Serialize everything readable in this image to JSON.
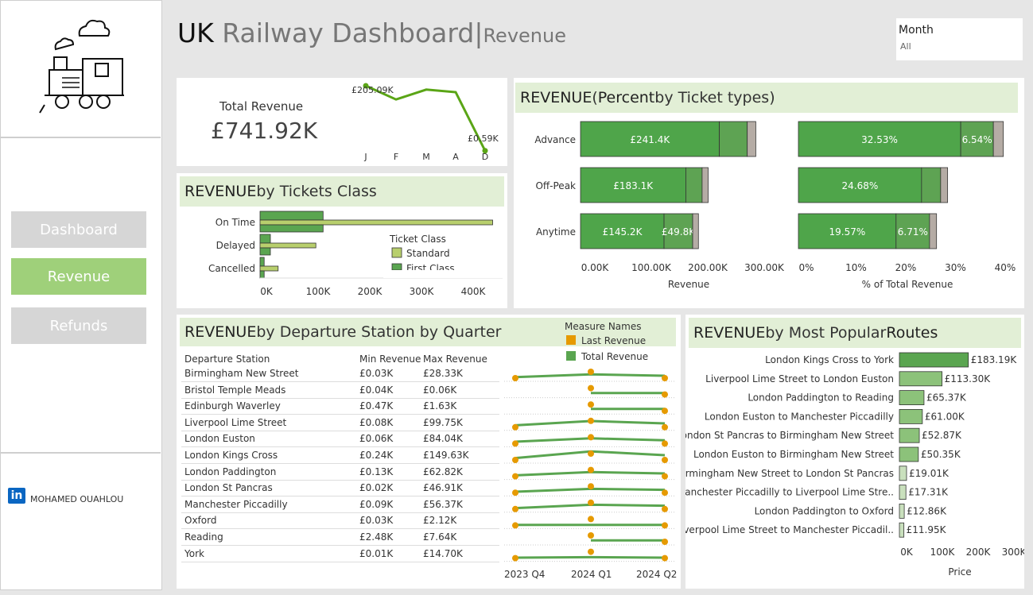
{
  "title": {
    "main_bold": "UK",
    "main_rest": " Railway Dashboard",
    "separator": "|",
    "sub": "Revenue"
  },
  "month_filter": {
    "label": "Month",
    "value": "All"
  },
  "nav": {
    "dashboard": "Dashboard",
    "revenue": "Revenue",
    "refunds": "Refunds",
    "active_color": "#9fd07a"
  },
  "author": {
    "name": "MOHAMED OUAHLOU",
    "icon": "linkedin-icon",
    "icon_text": "in"
  },
  "total_revenue": {
    "label": "Total Revenue",
    "value": "£741.92K",
    "spark": {
      "months": [
        "J",
        "F",
        "M",
        "A",
        "D"
      ],
      "values_k": [
        205.09,
        162,
        193,
        185,
        0.59
      ],
      "first_label": "£205.09K",
      "last_label": "£0.59K"
    }
  },
  "tickets_class": {
    "header_bold": "REVENUE",
    "header_rest": " by Tickets Class",
    "categories": [
      "On Time",
      "Delayed",
      "Cancelled"
    ],
    "standard_k": [
      450,
      108,
      35
    ],
    "first_class_k": [
      122,
      20,
      8
    ],
    "xticks": [
      "0K",
      "100K",
      "200K",
      "300K",
      "400K"
    ],
    "legend_title": "Ticket Class",
    "legend": [
      "Standard",
      "First Class"
    ],
    "colors": {
      "standard": "#b8cf6d",
      "first": "#5aa550"
    }
  },
  "ticket_types": {
    "header_bold1": "REVENUE",
    "header_mid1": " (",
    "header_bold2": "Percent",
    "header_rest": " by Ticket types)",
    "categories": [
      "Advance",
      "Off-Peak",
      "Anytime"
    ],
    "revenue": {
      "seg1": [
        241.4,
        183.1,
        145.2
      ],
      "seg2": [
        48.5,
        28.3,
        49.8
      ],
      "seg3": [
        14.8,
        10.5,
        10.0
      ],
      "seg1_labels": [
        "£241.4K",
        "£183.1K",
        "£145.2K"
      ],
      "seg2_labels": [
        "",
        "",
        "£49.8K"
      ],
      "xticks": [
        "0.00K",
        "100.00K",
        "200.00K",
        "300.00K"
      ],
      "xlabel": "Revenue"
    },
    "percent": {
      "seg1": [
        32.53,
        24.68,
        19.57
      ],
      "seg2": [
        6.54,
        3.82,
        6.71
      ],
      "seg3": [
        2.0,
        1.4,
        1.4
      ],
      "seg1_labels": [
        "32.53%",
        "24.68%",
        "19.57%"
      ],
      "seg2_labels": [
        "6.54%",
        "",
        "6.71%"
      ],
      "xticks": [
        "0%",
        "10%",
        "20%",
        "30%",
        "40%"
      ],
      "xlabel": "% of Total Revenue"
    },
    "colors": {
      "seg1": "#4fa54a",
      "seg2": "#5ea353",
      "seg3": "#b5aca5"
    }
  },
  "departure": {
    "header_bold": "REVENUE",
    "header_rest": " by Departure Station by Quarter",
    "legend_title": "Measure Names",
    "legend": [
      "Last Revenue",
      "Total Revenue"
    ],
    "colors": {
      "last": "#e69a00",
      "total": "#5aa550"
    },
    "columns": [
      "Departure Station",
      "Min Revenue",
      "Max Revenue"
    ],
    "quarters": [
      "2023 Q4",
      "2024 Q1",
      "2024 Q2"
    ],
    "rows": [
      {
        "station": "Birmingham New Street",
        "min": "£0.03K",
        "max": "£28.33K",
        "line": [
          0.1,
          0.4,
          0.25
        ],
        "q4": true
      },
      {
        "station": "Bristol Temple Meads",
        "min": "£0.04K",
        "max": "£0.06K",
        "line": [
          null,
          0.15,
          0.15
        ],
        "q4": false
      },
      {
        "station": "Edinburgh Waverley",
        "min": "£0.47K",
        "max": "£1.63K",
        "line": [
          null,
          0.2,
          0.2
        ],
        "q4": false
      },
      {
        "station": "Liverpool Lime Street",
        "min": "£0.08K",
        "max": "£99.75K",
        "line": [
          0.2,
          0.65,
          0.4
        ],
        "q4": true
      },
      {
        "station": "London Euston",
        "min": "£0.06K",
        "max": "£84.04K",
        "line": [
          0.2,
          0.55,
          0.35
        ],
        "q4": true
      },
      {
        "station": "London Kings Cross",
        "min": "£0.24K",
        "max": "£149.63K",
        "line": [
          0.2,
          0.9,
          0.5
        ],
        "q4": true
      },
      {
        "station": "London Paddington",
        "min": "£0.13K",
        "max": "£62.82K",
        "line": [
          0.1,
          0.45,
          0.3
        ],
        "q4": true
      },
      {
        "station": "London St Pancras",
        "min": "£0.02K",
        "max": "£46.91K",
        "line": [
          0.1,
          0.4,
          0.3
        ],
        "q4": true
      },
      {
        "station": "Manchester Piccadilly",
        "min": "£0.09K",
        "max": "£56.37K",
        "line": [
          0.1,
          0.45,
          0.35
        ],
        "q4": true
      },
      {
        "station": "Oxford",
        "min": "£0.03K",
        "max": "£2.12K",
        "line": [
          0.05,
          0.05,
          0.05
        ],
        "q4": true
      },
      {
        "station": "Reading",
        "min": "£2.48K",
        "max": "£7.64K",
        "line": [
          null,
          0.15,
          0.15
        ],
        "q4": false
      },
      {
        "station": "York",
        "min": "£0.01K",
        "max": "£14.70K",
        "line": [
          0.05,
          0.1,
          0.05
        ],
        "q4": true
      }
    ]
  },
  "routes": {
    "header_bold": "REVENUE",
    "header_rest": " by Most Popular ",
    "header_bold2": "Routes",
    "items": [
      {
        "route": "London Kings Cross to York",
        "value": 183.19,
        "label": "£183.19K"
      },
      {
        "route": "Liverpool Lime Street to London Euston",
        "value": 113.3,
        "label": "£113.30K"
      },
      {
        "route": "London Paddington to Reading",
        "value": 65.37,
        "label": "£65.37K"
      },
      {
        "route": "London Euston to Manchester Piccadilly",
        "value": 61.0,
        "label": "£61.00K"
      },
      {
        "route": "London St Pancras to Birmingham New Street",
        "value": 52.87,
        "label": "£52.87K"
      },
      {
        "route": "London Euston to Birmingham New Street",
        "value": 50.35,
        "label": "£50.35K"
      },
      {
        "route": "Birmingham New Street to London St Pancras",
        "value": 19.01,
        "label": "£19.01K"
      },
      {
        "route": "Manchester Piccadilly to Liverpool Lime Stre..",
        "value": 17.31,
        "label": "£17.31K"
      },
      {
        "route": "London Paddington to Oxford",
        "value": 12.86,
        "label": "£12.86K"
      },
      {
        "route": "Liverpool Lime Street to Manchester Piccadil..",
        "value": 11.95,
        "label": "£11.95K"
      }
    ],
    "xticks": [
      "0K",
      "100K",
      "200K",
      "300K"
    ],
    "xlabel": "Price",
    "colors": {
      "top": "#5aa550",
      "mid": "#8cc27a",
      "low": "#c9e0bd"
    }
  }
}
